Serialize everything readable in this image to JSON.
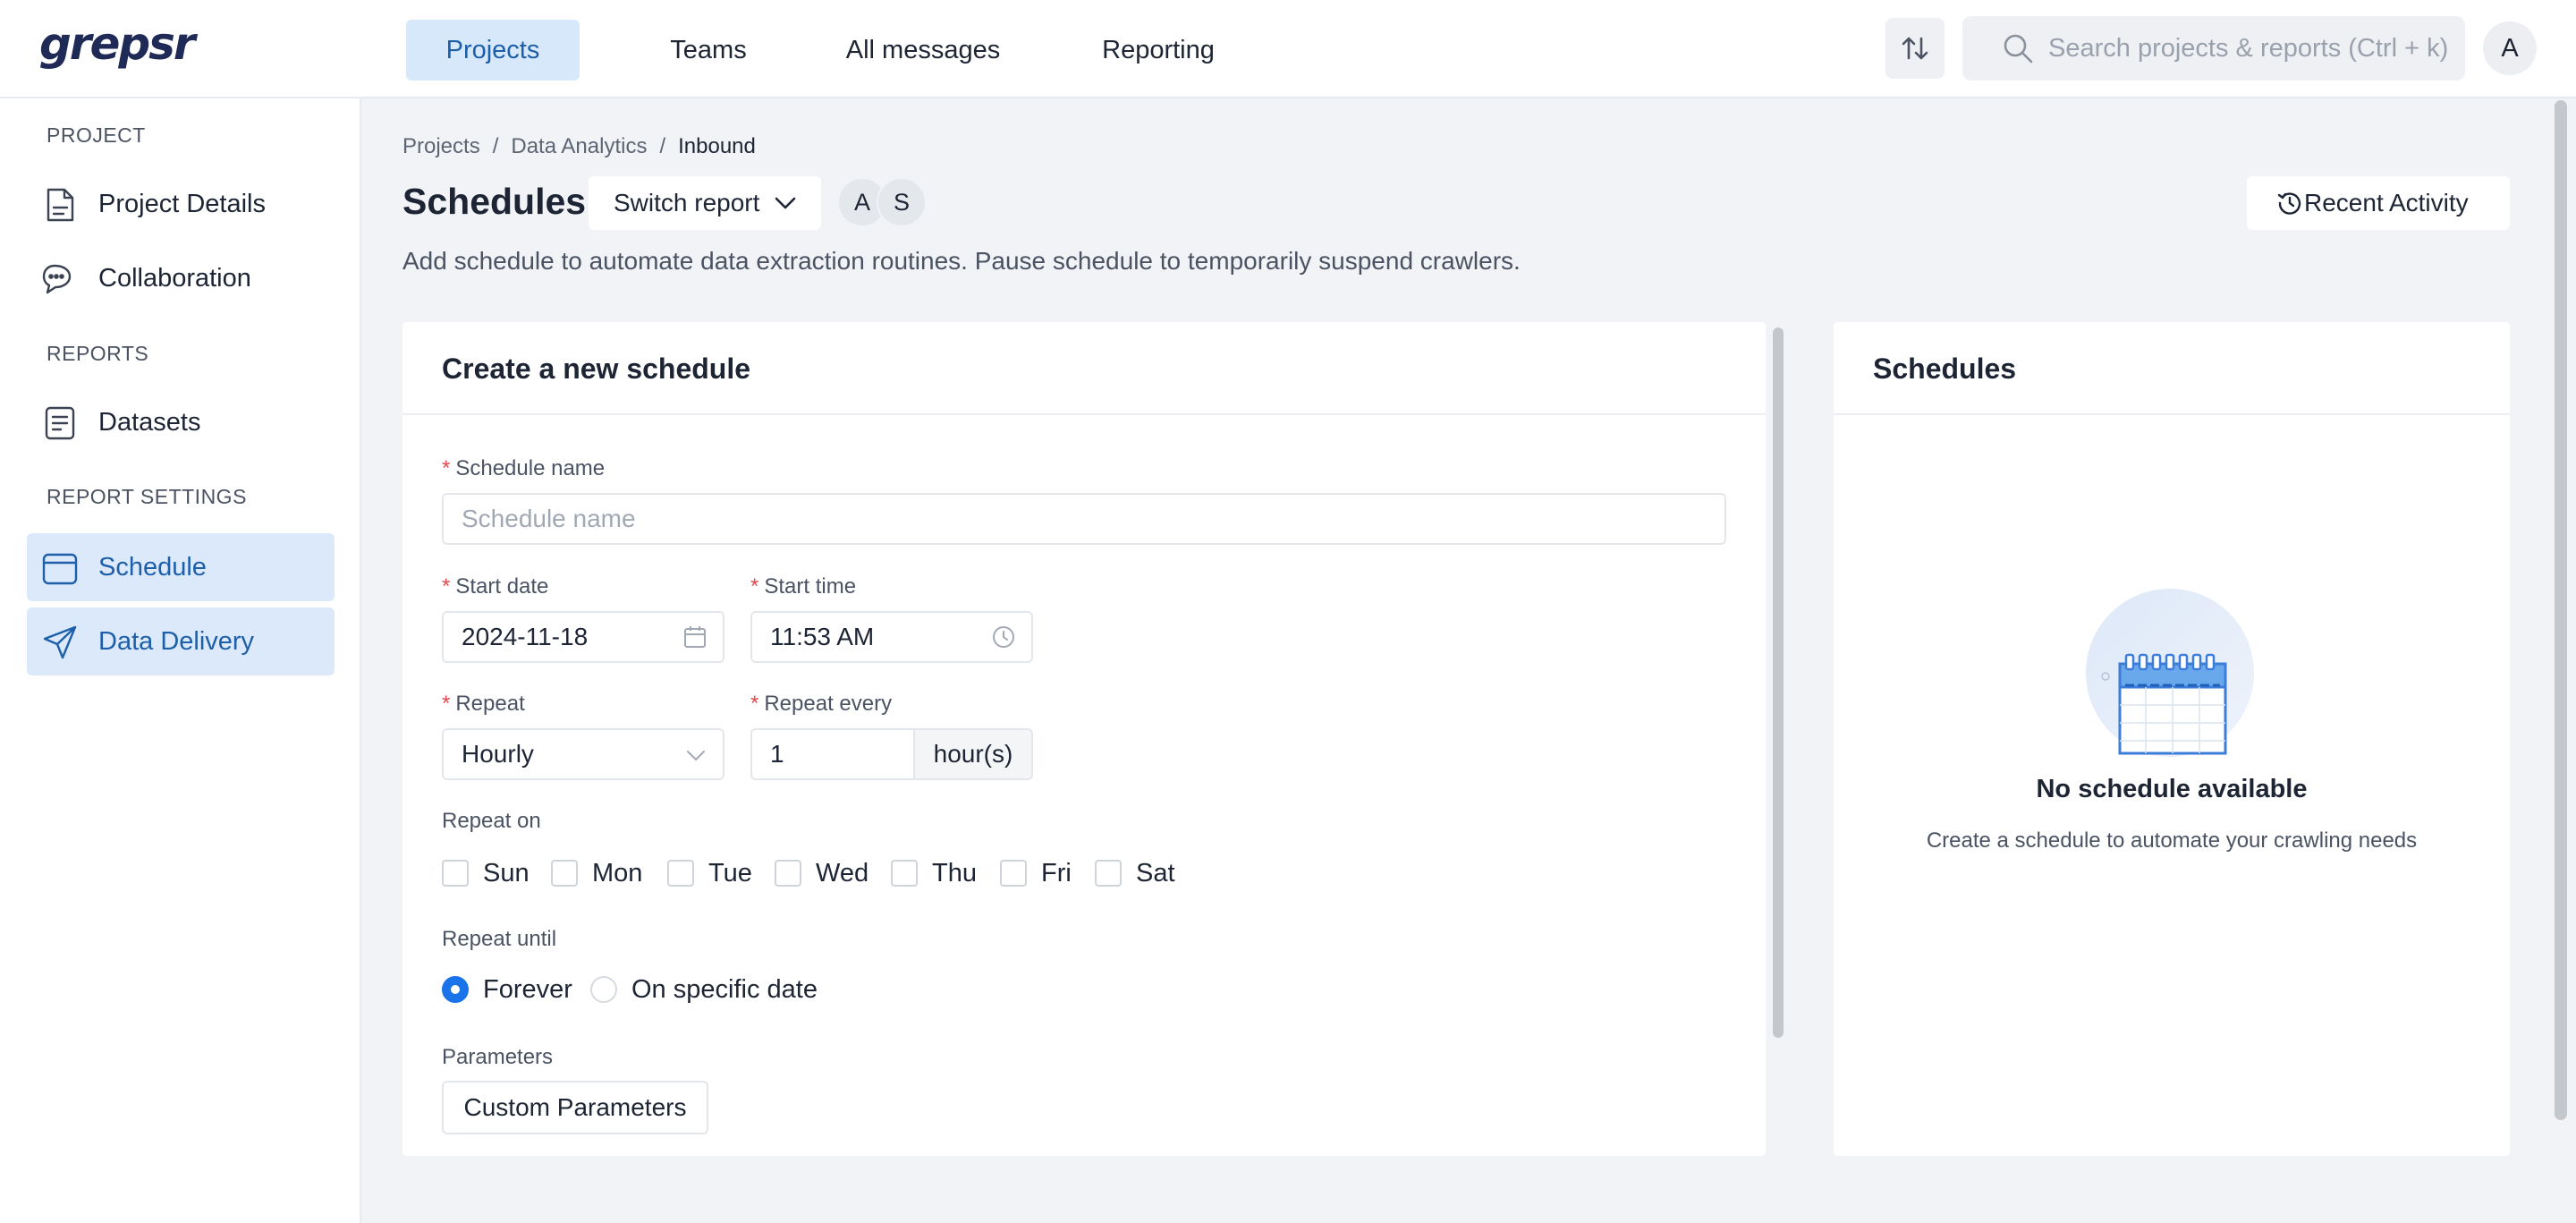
{
  "app": {
    "logo": "grepsr"
  },
  "topnav": {
    "items": [
      {
        "label": "Projects",
        "active": true
      },
      {
        "label": "Teams",
        "active": false
      },
      {
        "label": "All messages",
        "active": false
      },
      {
        "label": "Reporting",
        "active": false
      }
    ],
    "search_placeholder": "Search projects & reports (Ctrl + k)",
    "avatar": "A"
  },
  "sidebar": {
    "sections": [
      {
        "label": "PROJECT",
        "items": [
          {
            "label": "Project Details",
            "icon": "document-icon"
          },
          {
            "label": "Collaboration",
            "icon": "chat-icon"
          }
        ]
      },
      {
        "label": "REPORTS",
        "items": [
          {
            "label": "Datasets",
            "icon": "list-doc-icon"
          }
        ]
      },
      {
        "label": "REPORT SETTINGS",
        "items": [
          {
            "label": "Schedule",
            "icon": "calendar-icon",
            "active": true
          },
          {
            "label": "Data Delivery",
            "icon": "send-icon",
            "active": true
          }
        ]
      }
    ]
  },
  "breadcrumb": [
    "Projects",
    "Data Analytics",
    "Inbound"
  ],
  "header": {
    "title": "Schedules",
    "switch_label": "Switch report",
    "avatars": [
      "A",
      "S"
    ],
    "recent_label": "Recent Activity",
    "subtitle": "Add schedule to automate data extraction routines. Pause schedule to temporarily suspend crawlers."
  },
  "form": {
    "title": "Create a new schedule",
    "name_label": "Schedule name",
    "name_placeholder": "Schedule name",
    "start_date_label": "Start date",
    "start_date_value": "2024-11-18",
    "start_time_label": "Start time",
    "start_time_value": "11:53 AM",
    "repeat_label": "Repeat",
    "repeat_value": "Hourly",
    "repeat_every_label": "Repeat every",
    "repeat_every_value": "1",
    "repeat_every_unit": "hour(s)",
    "repeat_on_label": "Repeat on",
    "days": [
      "Sun",
      "Mon",
      "Tue",
      "Wed",
      "Thu",
      "Fri",
      "Sat"
    ],
    "repeat_until_label": "Repeat until",
    "until_options": [
      {
        "label": "Forever",
        "selected": true
      },
      {
        "label": "On specific date",
        "selected": false
      }
    ],
    "parameters_label": "Parameters",
    "custom_params_label": "Custom Parameters"
  },
  "schedules_panel": {
    "title": "Schedules",
    "empty_title": "No schedule available",
    "empty_subtitle": "Create a schedule to automate your crawling needs"
  },
  "colors": {
    "accent": "#1a73e8",
    "active_bg": "#dbe9fa",
    "active_text": "#1d5fa8",
    "required": "#e5484d"
  }
}
